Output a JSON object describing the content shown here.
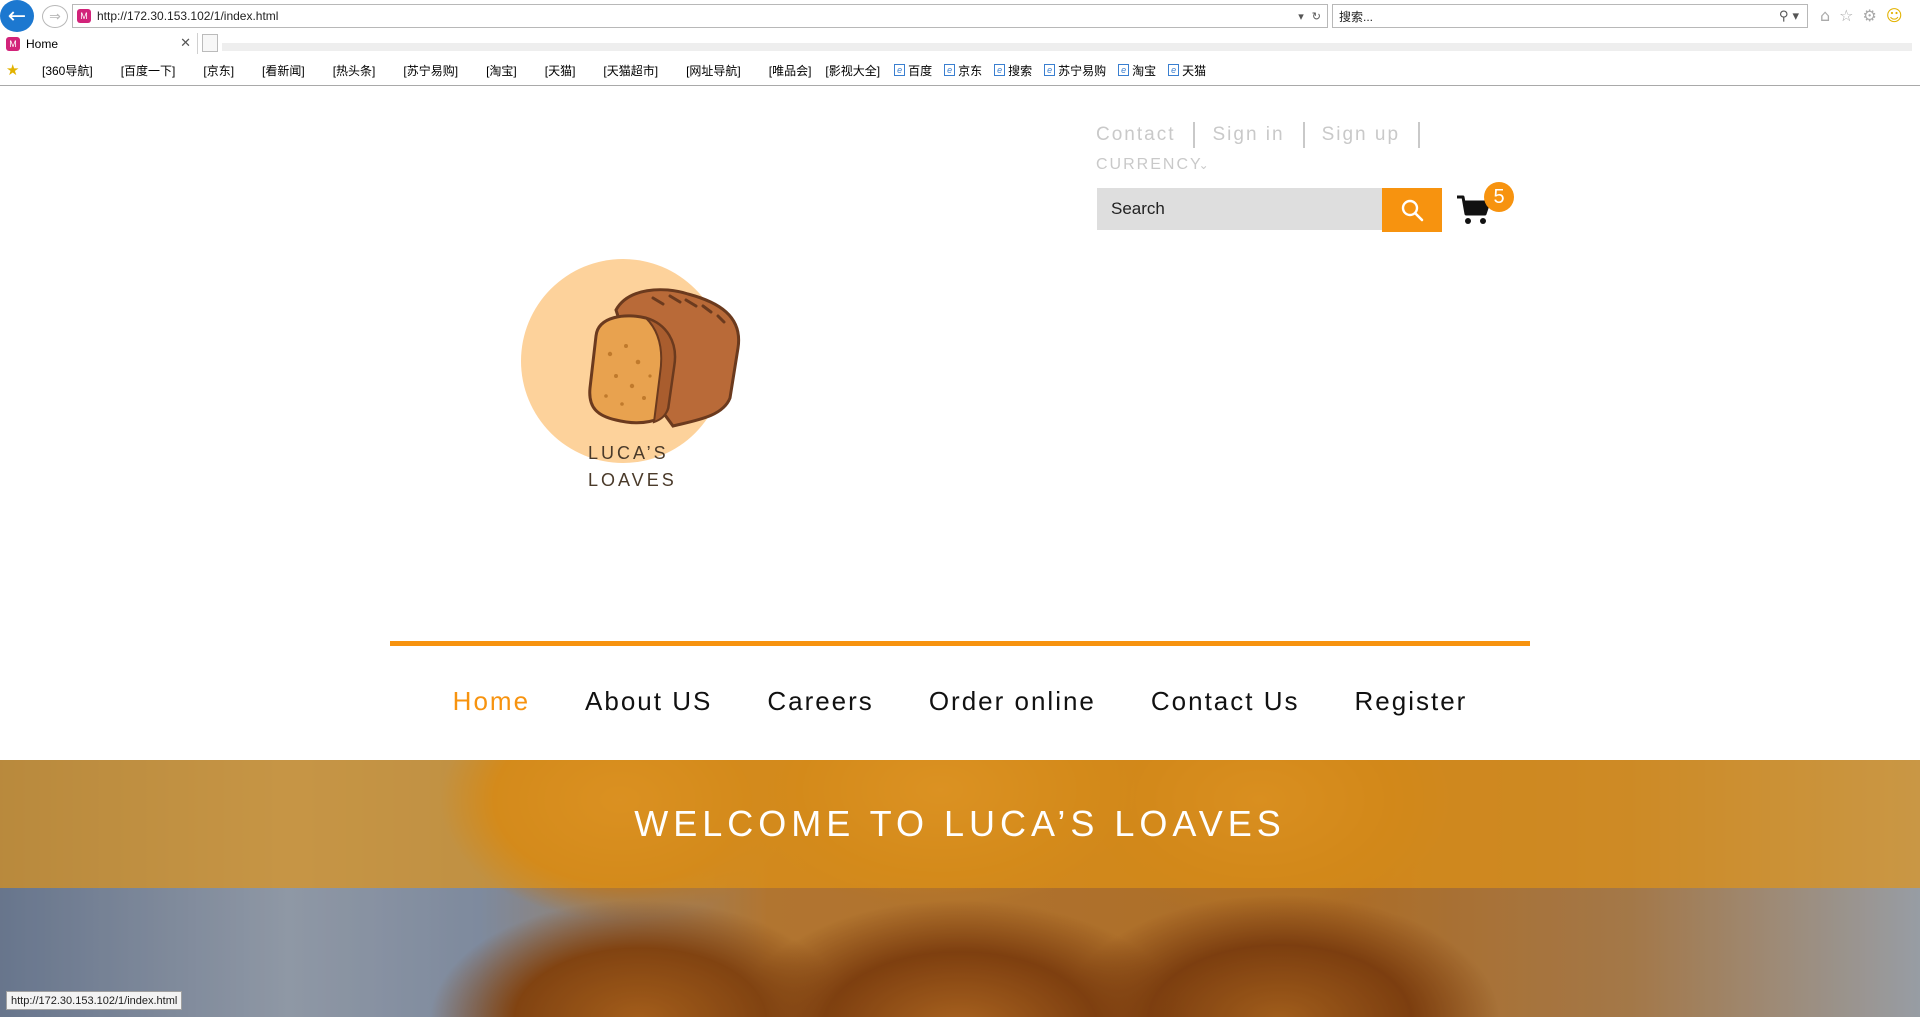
{
  "browser": {
    "url": "http://172.30.153.102/1/index.html",
    "search_placeholder": "搜索...",
    "tab_title": "Home",
    "status_url": "http://172.30.153.102/1/index.html",
    "favorites": [
      "[360导航]",
      "[百度一下]",
      "[京东]",
      "[看新闻]",
      "[热头条]",
      "[苏宁易购]",
      "[淘宝]",
      "[天猫]",
      "[天猫超市]",
      "[网址导航]",
      "[唯品会]",
      "[影视大全]"
    ],
    "favorites_ie": [
      "百度",
      "京东",
      "搜索",
      "苏宁易购",
      "淘宝",
      "天猫"
    ]
  },
  "header": {
    "links": [
      "Contact",
      "Sign in",
      "Sign up"
    ],
    "currency_label": "CURRENCY",
    "search_placeholder": "Search",
    "cart_count": "5"
  },
  "logo": {
    "line1": "LUCA’S",
    "line2": "LOAVES"
  },
  "nav": {
    "items": [
      "Home",
      "About US",
      "Careers",
      "Order online",
      "Contact Us",
      "Register"
    ],
    "active": "Home"
  },
  "hero": {
    "title": "WELCOME TO LUCA’S LOAVES"
  },
  "colors": {
    "accent": "#f7930f",
    "link_muted": "#c9c9c9"
  }
}
